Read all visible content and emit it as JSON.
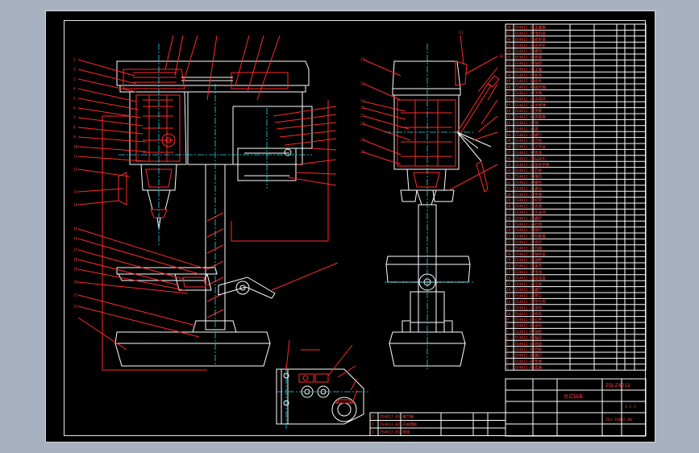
{
  "title_block": {
    "name_main": "台式钻床",
    "drawing_number": "ZSJ-Z4012",
    "scale": "1:2.5",
    "sheet_code": "ZSJ-Z4012-00"
  },
  "bom": {
    "rows": [
      {
        "no": "58",
        "code": "ZS4012-58",
        "name": "主轴箱"
      },
      {
        "no": "57",
        "code": "ZS4012-57",
        "name": "电机座"
      },
      {
        "no": "56",
        "code": "ZS4012-56",
        "name": "皮带罩"
      },
      {
        "no": "55",
        "code": "ZS4012-55",
        "name": "皮带轮"
      },
      {
        "no": "54",
        "code": "ZS4012-54",
        "name": "螺母"
      },
      {
        "no": "53",
        "code": "ZS4012-53",
        "name": "垫圈"
      },
      {
        "no": "52",
        "code": "ZS4012-52",
        "name": "轴承"
      },
      {
        "no": "51",
        "code": "ZS4012-51",
        "name": "主轴"
      },
      {
        "no": "50",
        "code": "ZS4012-50",
        "name": "套筒"
      },
      {
        "no": "49",
        "code": "ZS4012-49",
        "name": "齿条"
      },
      {
        "no": "48",
        "code": "ZS4012-48",
        "name": "齿轮轴"
      },
      {
        "no": "47",
        "code": "ZS4012-47",
        "name": "手柄"
      },
      {
        "no": "46",
        "code": "ZS4012-46",
        "name": "手柄杆"
      },
      {
        "no": "45",
        "code": "ZS4012-45",
        "name": "手柄球"
      },
      {
        "no": "44",
        "code": "ZS4012-44",
        "name": "弹簧"
      },
      {
        "no": "43",
        "code": "ZS4012-43",
        "name": "弹簧座"
      },
      {
        "no": "42",
        "code": "ZS4012-42",
        "name": "销"
      },
      {
        "no": "41",
        "code": "ZS4012-41",
        "name": "键"
      },
      {
        "no": "40",
        "code": "ZS4012-40",
        "name": "螺钉"
      },
      {
        "no": "39",
        "code": "ZS4012-39",
        "name": "立柱"
      },
      {
        "no": "38",
        "code": "ZS4012-38",
        "name": "工作台"
      },
      {
        "no": "37",
        "code": "ZS4012-37",
        "name": "底座"
      },
      {
        "no": "36",
        "code": "ZS4012-36",
        "name": "钻夹头"
      },
      {
        "no": "35",
        "code": "ZS4012-35",
        "name": "锁紧手柄"
      },
      {
        "no": "34",
        "code": "ZS4012-34",
        "name": "开关"
      },
      {
        "no": "33",
        "code": "ZS4012-33",
        "name": "电机"
      },
      {
        "no": "32",
        "code": "ZS4012-32",
        "name": "螺栓"
      },
      {
        "no": "31",
        "code": "ZS4012-31",
        "name": "螺母"
      },
      {
        "no": "30",
        "code": "ZS4012-30",
        "name": "垫圈"
      },
      {
        "no": "29",
        "code": "ZS4012-29",
        "name": "托架"
      },
      {
        "no": "28",
        "code": "ZS4012-28",
        "name": "支臂"
      },
      {
        "no": "27",
        "code": "ZS4012-27",
        "name": "夹紧块"
      },
      {
        "no": "26",
        "code": "ZS4012-26",
        "name": "螺杆"
      },
      {
        "no": "25",
        "code": "ZS4012-25",
        "name": "标牌"
      },
      {
        "no": "24",
        "code": "ZS4012-24",
        "name": "铆钉"
      },
      {
        "no": "23",
        "code": "ZS4012-23",
        "name": "刻度盘"
      },
      {
        "no": "22",
        "code": "ZS4012-22",
        "name": "指针"
      },
      {
        "no": "21",
        "code": "ZS4012-21",
        "name": "挡圈"
      },
      {
        "no": "20",
        "code": "ZS4012-20",
        "name": "轴承盖"
      },
      {
        "no": "19",
        "code": "ZS4012-19",
        "name": "油杯"
      },
      {
        "no": "18",
        "code": "ZS4012-18",
        "name": "罩壳"
      },
      {
        "no": "17",
        "code": "ZS4012-17",
        "name": "电线"
      },
      {
        "no": "16",
        "code": "ZS4012-16",
        "name": "接线盒"
      },
      {
        "no": "15",
        "code": "ZS4012-15",
        "name": "压板"
      },
      {
        "no": "14",
        "code": "ZS4012-14",
        "name": "螺钉"
      },
      {
        "no": "13",
        "code": "ZS4012-13",
        "name": "垫片"
      },
      {
        "no": "12",
        "code": "ZS4012-12",
        "name": "定位销"
      },
      {
        "no": "11",
        "code": "ZS4012-11",
        "name": "滑块"
      },
      {
        "no": "10",
        "code": "ZS4012-10",
        "name": "导轨"
      },
      {
        "no": "9",
        "code": "ZS4012-09",
        "name": "丝杆"
      },
      {
        "no": "8",
        "code": "ZS4012-08",
        "name": "手轮"
      },
      {
        "no": "7",
        "code": "ZS4012-07",
        "name": "轴套"
      },
      {
        "no": "6",
        "code": "ZS4012-06",
        "name": "轴承"
      },
      {
        "no": "5",
        "code": "ZS4012-05",
        "name": "端盖"
      },
      {
        "no": "4",
        "code": "ZS4012-04",
        "name": "挡板"
      },
      {
        "no": "3",
        "code": "ZS4012-03",
        "name": "螺钉"
      },
      {
        "no": "2",
        "code": "ZS4012-02",
        "name": "垫圈"
      },
      {
        "no": "1",
        "code": "ZS4012-01",
        "name": "底座"
      }
    ],
    "footer_rows": [
      {
        "no": "3",
        "code": "ZS4012-03",
        "name": "电气箱"
      },
      {
        "no": "2",
        "code": "ZS4012-02",
        "name": "开关面板"
      },
      {
        "no": "1",
        "code": "ZS4012-01",
        "name": "按钮"
      }
    ]
  },
  "balloons": {
    "front_left": [
      "1",
      "2",
      "3",
      "4",
      "5",
      "6",
      "7",
      "8",
      "9",
      "10",
      "11",
      "12",
      "13",
      "14",
      "15",
      "16",
      "17",
      "18",
      "19",
      "20",
      "21",
      "22"
    ],
    "side": [
      "23",
      "24",
      "25",
      "26",
      "27",
      "28",
      "29",
      "30",
      "31",
      "32"
    ]
  }
}
